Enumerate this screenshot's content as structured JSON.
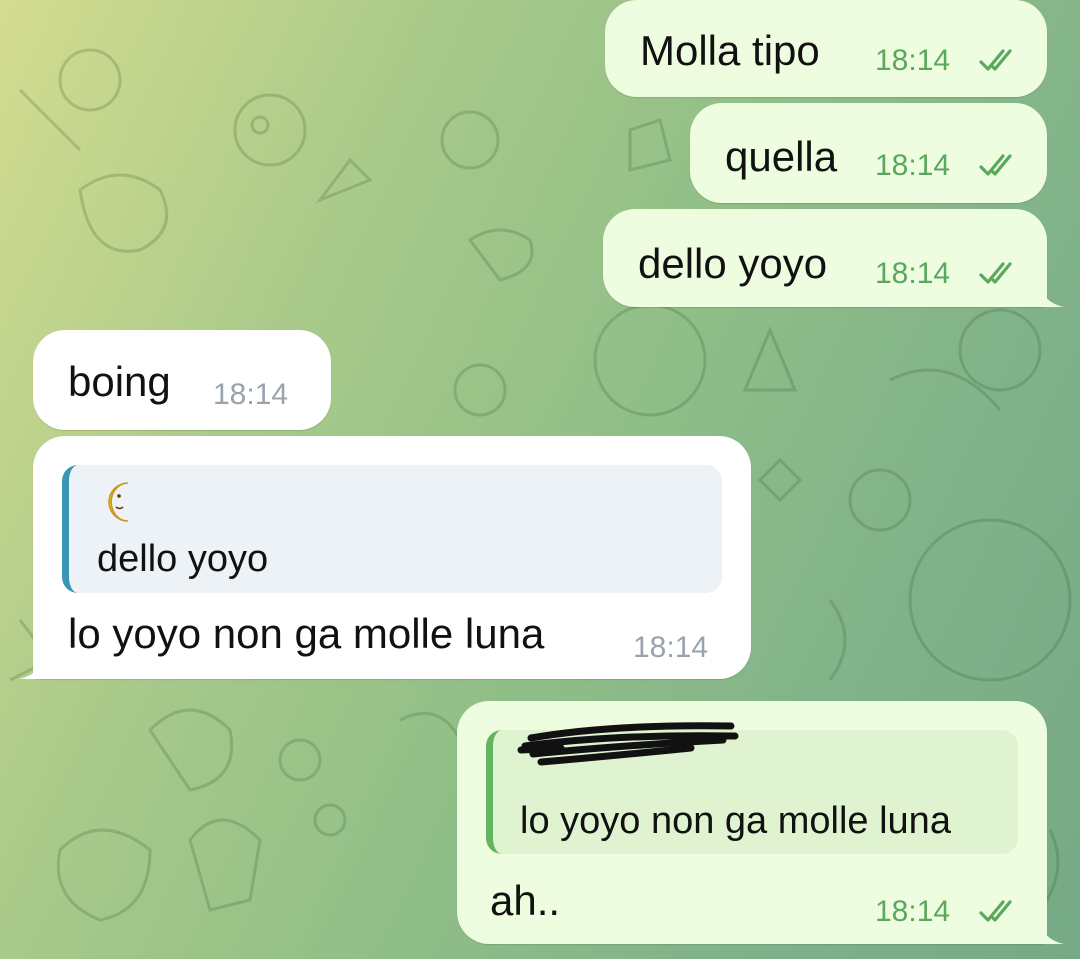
{
  "messages": [
    {
      "id": "m1",
      "direction": "outgoing",
      "text": "Molla tipo",
      "time": "18:14",
      "status": "read"
    },
    {
      "id": "m2",
      "direction": "outgoing",
      "text": "quella",
      "time": "18:14",
      "status": "read"
    },
    {
      "id": "m3",
      "direction": "outgoing",
      "text": "dello yoyo",
      "time": "18:14",
      "status": "read"
    },
    {
      "id": "m4",
      "direction": "incoming",
      "text": "boing",
      "time": "18:14"
    },
    {
      "id": "m5",
      "direction": "incoming",
      "text": "lo yoyo non ga molle luna",
      "time": "18:14",
      "reply": {
        "sender_icon": "crescent-moon-emoji",
        "text": "dello yoyo"
      }
    },
    {
      "id": "m6",
      "direction": "outgoing",
      "text": "ah..",
      "time": "18:14",
      "status": "read",
      "reply": {
        "sender": "[redacted]",
        "text": "lo yoyo non ga molle luna"
      }
    }
  ],
  "colors": {
    "outgoing_bubble": "#eefcdf",
    "incoming_bubble": "#ffffff",
    "outgoing_time": "#5aa85e",
    "incoming_time": "#9aa3aa",
    "incoming_reply_bar": "#3a97b3",
    "outgoing_reply_bar": "#62b560"
  },
  "icons": {
    "read_status": "double-check-icon"
  }
}
